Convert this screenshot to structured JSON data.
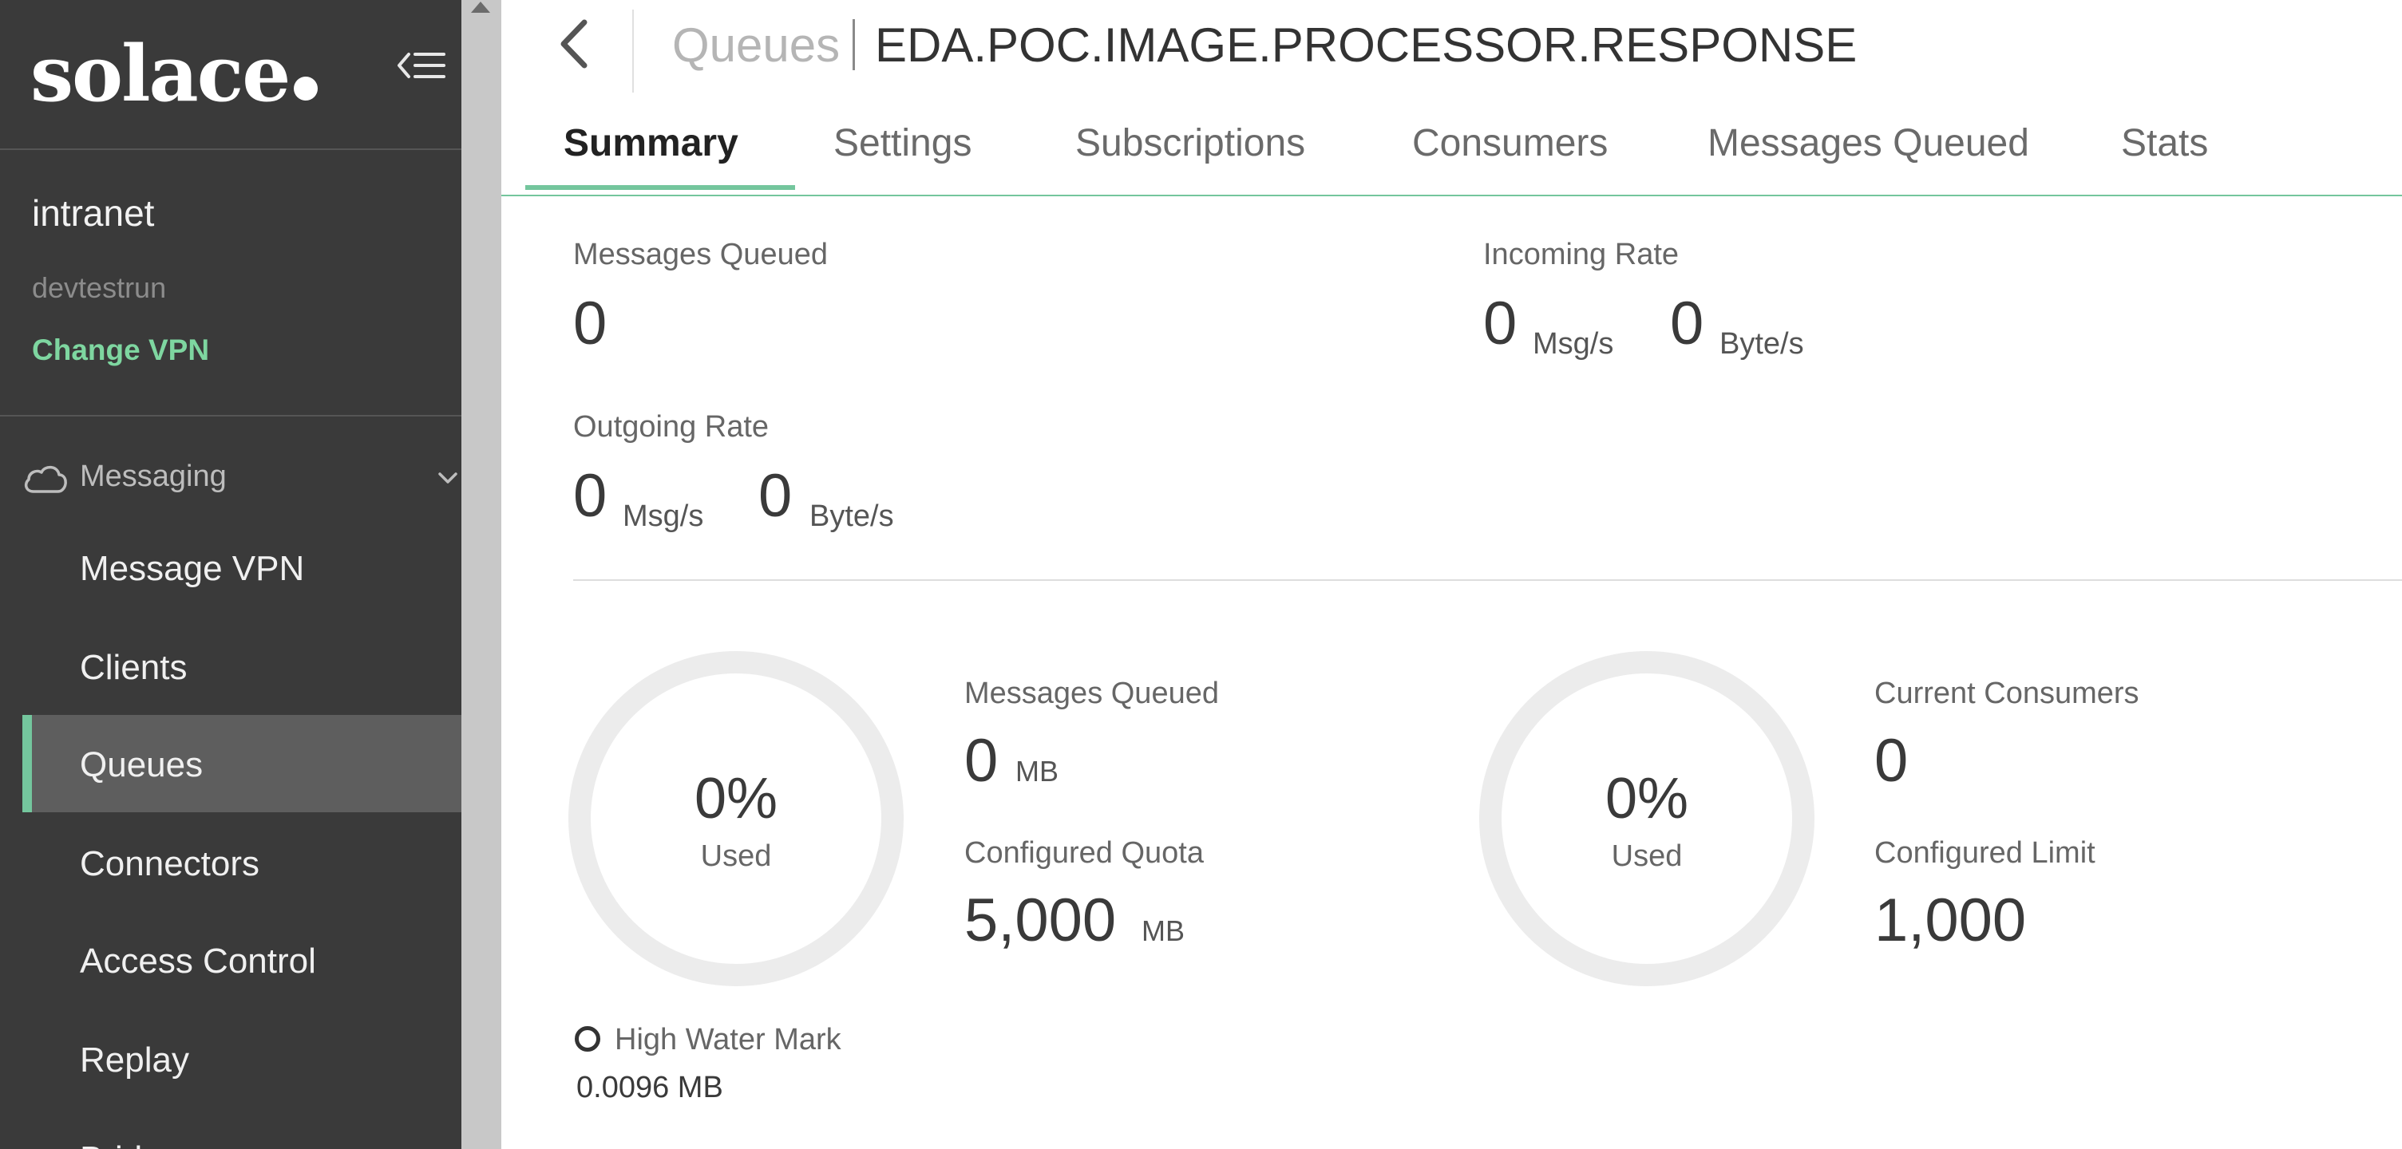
{
  "sidebar": {
    "logo": "solace",
    "vpn_name": "intranet",
    "vpn_sub": "devtestrun",
    "change_vpn": "Change VPN",
    "section_label": "Messaging",
    "items": [
      {
        "label": "Message VPN"
      },
      {
        "label": "Clients"
      },
      {
        "label": "Queues",
        "active": true
      },
      {
        "label": "Connectors"
      },
      {
        "label": "Access Control"
      },
      {
        "label": "Replay"
      },
      {
        "label": "Bridges"
      }
    ]
  },
  "header": {
    "breadcrumb": "Queues",
    "queue_name": "EDA.POC.IMAGE.PROCESSOR.RESPONSE"
  },
  "tabs": [
    {
      "label": "Summary",
      "active": true
    },
    {
      "label": "Settings"
    },
    {
      "label": "Subscriptions"
    },
    {
      "label": "Consumers"
    },
    {
      "label": "Messages Queued"
    },
    {
      "label": "Stats"
    }
  ],
  "summary": {
    "messages_queued_label": "Messages Queued",
    "messages_queued_value": "0",
    "incoming_rate_label": "Incoming Rate",
    "incoming_msg_value": "0",
    "incoming_msg_unit": "Msg/s",
    "incoming_byte_value": "0",
    "incoming_byte_unit": "Byte/s",
    "outgoing_rate_label": "Outgoing Rate",
    "outgoing_msg_value": "0",
    "outgoing_msg_unit": "Msg/s",
    "outgoing_byte_value": "0",
    "outgoing_byte_unit": "Byte/s"
  },
  "storage": {
    "donut_pct": "0%",
    "donut_fraction": 0,
    "donut_used": "Used",
    "queued_label": "Messages Queued",
    "queued_value": "0",
    "queued_unit": "MB",
    "quota_label": "Configured Quota",
    "quota_value": "5,000",
    "quota_unit": "MB",
    "hwm_label": "High Water Mark",
    "hwm_value": "0.0096 MB"
  },
  "consumers": {
    "donut_pct": "0%",
    "donut_fraction": 0,
    "donut_used": "Used",
    "current_label": "Current Consumers",
    "current_value": "0",
    "limit_label": "Configured Limit",
    "limit_value": "1,000"
  },
  "colors": {
    "accent": "#74c69d",
    "sidebar_bg": "#3a3a3a",
    "active_item_bg": "#5e5e5e",
    "donut_track": "#ececec"
  }
}
